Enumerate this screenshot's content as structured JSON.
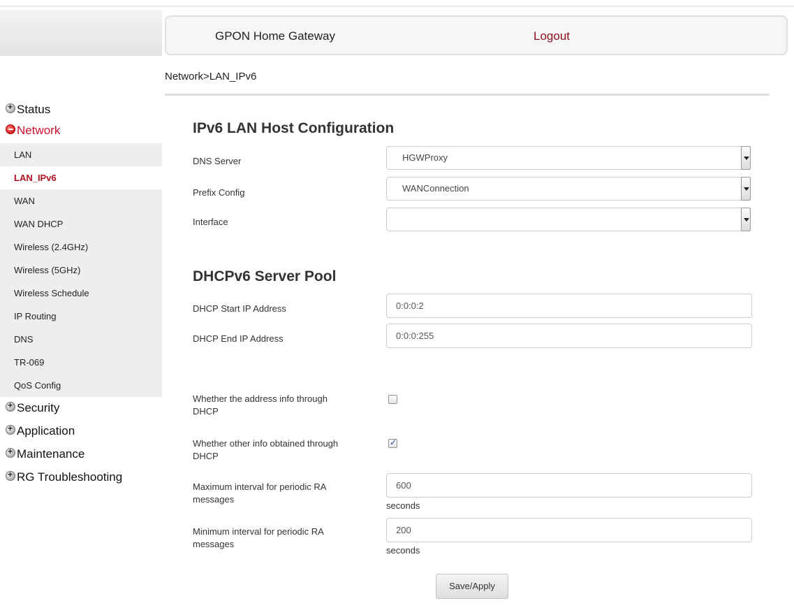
{
  "header": {
    "title": "GPON Home Gateway",
    "logout_label": "Logout"
  },
  "breadcrumb": "Network>LAN_IPv6",
  "sidebar": {
    "groups": {
      "status": "Status",
      "network": "Network",
      "security": "Security",
      "application": "Application",
      "maintenance": "Maintenance",
      "troubleshooting": "RG Troubleshooting"
    },
    "network_items": [
      "LAN",
      "LAN_IPv6",
      "WAN",
      "WAN DHCP",
      "Wireless (2.4GHz)",
      "Wireless (5GHz)",
      "Wireless Schedule",
      "IP Routing",
      "DNS",
      "TR-069",
      "QoS Config"
    ],
    "selected_item": "LAN_IPv6"
  },
  "host_config": {
    "title": "IPv6 LAN Host Configuration",
    "dns_server": {
      "label": "DNS Server",
      "value": "HGWProxy"
    },
    "prefix_config": {
      "label": "Prefix Config",
      "value": "WANConnection"
    },
    "interface": {
      "label": "Interface",
      "value": ""
    }
  },
  "dhcp_pool": {
    "title": "DHCPv6 Server Pool",
    "start_ip": {
      "label": "DHCP Start IP Address",
      "value": "0:0:0:2"
    },
    "end_ip": {
      "label": "DHCP End IP Address",
      "value": "0:0:0:255"
    }
  },
  "options": {
    "address_info": {
      "label_line1": "Whether the address info through",
      "label_line2": "DHCP",
      "checked": false
    },
    "other_info": {
      "label_line1": "Whether other info obtained through",
      "label_line2": "DHCP",
      "checked": true
    },
    "max_ra": {
      "label_line1": "Maximum interval for periodic RA",
      "label_line2": "messages",
      "value": "600",
      "unit": "seconds"
    },
    "min_ra": {
      "label_line1": "Minimum interval for periodic RA",
      "label_line2": "messages",
      "value": "200",
      "unit": "seconds"
    }
  },
  "save_label": "Save/Apply"
}
